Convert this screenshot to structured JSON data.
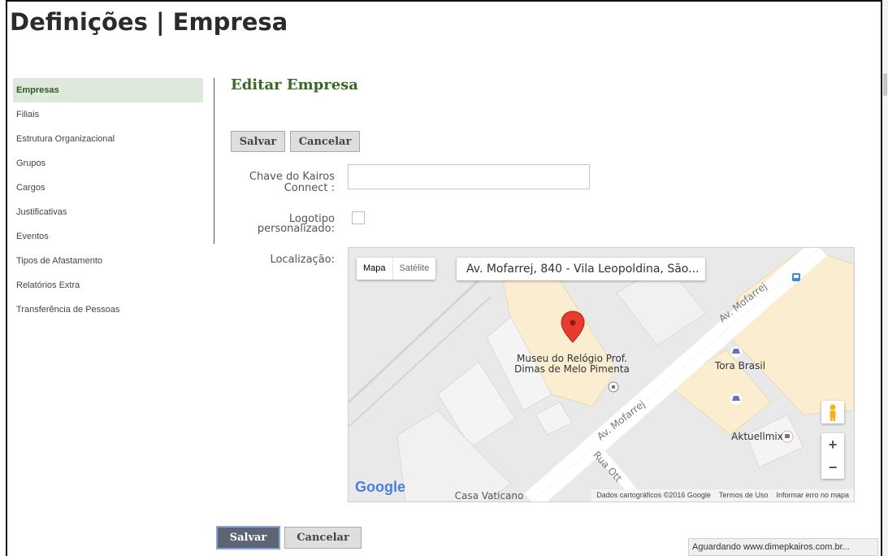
{
  "page": {
    "title": "Definições | Empresa"
  },
  "sidebar": {
    "items": [
      {
        "label": "Empresas",
        "active": true
      },
      {
        "label": "Filiais"
      },
      {
        "label": "Estrutura Organizacional"
      },
      {
        "label": "Grupos"
      },
      {
        "label": "Cargos"
      },
      {
        "label": "Justificativas"
      },
      {
        "label": "Eventos"
      },
      {
        "label": "Tipos de Afastamento"
      },
      {
        "label": "Relatórios Extra"
      },
      {
        "label": "Transferência de Pessoas"
      }
    ]
  },
  "main": {
    "section_title": "Editar Empresa",
    "top_buttons": {
      "save": "Salvar",
      "cancel": "Cancelar"
    },
    "bottom_buttons": {
      "save": "Salvar",
      "cancel": "Cancelar"
    },
    "form": {
      "kairos_key_label_line1": "Chave do Kairos",
      "kairos_key_label_line2": "Connect :",
      "kairos_key_value": "",
      "logo_label_line1": "Logotipo",
      "logo_label_line2": "personalizado:",
      "logo_checked": false,
      "location_label": "Localização:"
    },
    "map": {
      "type_map": "Mapa",
      "type_satellite": "Satélite",
      "address": "Av. Mofarrej, 840 - Vila Leopoldina, São...",
      "poi_museum_line1": "Museu do Relógio Prof.",
      "poi_museum_line2": "Dimas de Melo Pimenta",
      "poi_tora": "Tora Brasil",
      "poi_aktuell": "Aktuellmix",
      "road_mofarrej_1": "Av. Mofarrej",
      "road_mofarrej_2": "Av. Mofarrej",
      "road_rua": "Rua Ott",
      "poi_casa": "Casa Vaticano",
      "google": "Google",
      "attribution_data": "Dados cartográficos ©2016 Google",
      "attribution_terms": "Termos de Uso",
      "attribution_report": "Informar erro no mapa",
      "zoom_in": "+",
      "zoom_out": "−"
    }
  },
  "status_bar": {
    "text": "Aguardando www.dimepkairos.com.br..."
  }
}
